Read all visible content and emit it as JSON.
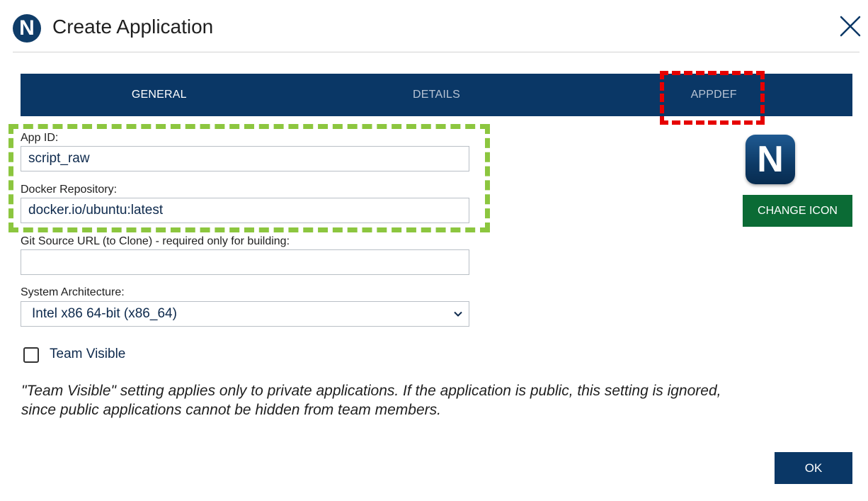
{
  "dialog": {
    "logo_letter": "N",
    "title": "Create Application"
  },
  "tabs": [
    {
      "label": "GENERAL"
    },
    {
      "label": "DETAILS"
    },
    {
      "label": "APPDEF"
    }
  ],
  "form": {
    "app_id": {
      "label": "App ID:",
      "value": "script_raw"
    },
    "docker_repo": {
      "label": "Docker Repository:",
      "value": "docker.io/ubuntu:latest"
    },
    "git_url": {
      "label": "Git Source URL (to Clone) - required only for building:",
      "value": ""
    },
    "architecture": {
      "label": "System Architecture:",
      "value": "Intel x86 64-bit (x86_64)"
    },
    "team_visible": {
      "label": "Team Visible",
      "checked": false
    },
    "note": "\"Team Visible\" setting applies only to private applications. If the application is public, this setting is ignored, since public applications cannot be hidden from team members."
  },
  "icon": {
    "letter": "N",
    "change_label": "CHANGE ICON"
  },
  "footer": {
    "ok_label": "OK"
  },
  "colors": {
    "navy": "#0a3766",
    "green_button": "#0b6b35",
    "annotation_red": "#e60000",
    "annotation_green": "#8cc63f"
  }
}
